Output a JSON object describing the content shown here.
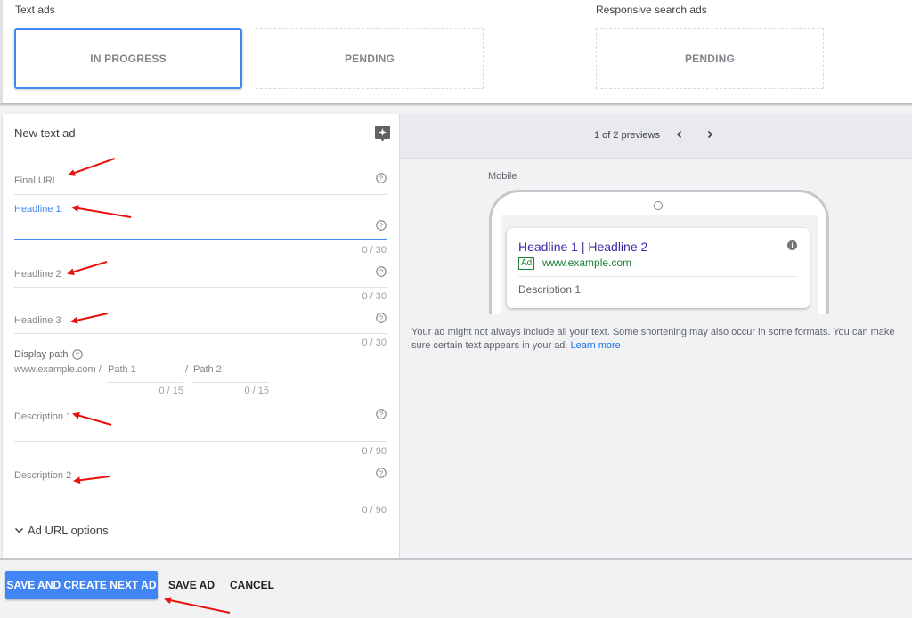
{
  "top": {
    "text_ads": {
      "title": "Text ads",
      "states": [
        "IN PROGRESS",
        "PENDING"
      ]
    },
    "responsive_search_ads": {
      "title": "Responsive search ads",
      "states": [
        "PENDING"
      ]
    }
  },
  "form": {
    "title": "New text ad",
    "tip_icon": "lightbulb-tip-icon",
    "fields": {
      "final_url": {
        "label": "Final URL"
      },
      "headline1": {
        "label": "Headline 1",
        "counter": "0 / 30"
      },
      "headline2": {
        "label": "Headline 2",
        "counter": "0 / 30"
      },
      "headline3": {
        "label": "Headline 3",
        "counter": "0 / 30"
      },
      "description1": {
        "label": "Description 1",
        "counter": "0 / 90"
      },
      "description2": {
        "label": "Description 2",
        "counter": "0 / 90"
      }
    },
    "display_path": {
      "label": "Display path",
      "domain": "www.example.com /",
      "path1_placeholder": "Path 1",
      "path1_counter": "0 / 15",
      "separator": "/",
      "path2_placeholder": "Path 2",
      "path2_counter": "0 / 15"
    },
    "ad_url_options": "Ad URL options"
  },
  "preview": {
    "counter": "1 of 2 previews",
    "prev_glyph": "‹",
    "next_glyph": "›",
    "device_label": "Mobile",
    "ad": {
      "headline": "Headline 1 | Headline 2",
      "badge": "Ad",
      "url": "www.example.com",
      "description": "Description 1",
      "info_glyph": "i"
    },
    "note": "Your ad might not always include all your text. Some shortening may also occur in some formats. You can make sure certain text appears in your ad.",
    "learn_more": "Learn more"
  },
  "actions": {
    "save_and_next": "SAVE AND CREATE NEXT AD",
    "save": "SAVE AD",
    "cancel": "CANCEL"
  },
  "colors": {
    "accent": "#4285f4",
    "ad_headline": "#3b2ca8",
    "ad_green": "#188038",
    "annotation_arrow": "#e8120c"
  }
}
